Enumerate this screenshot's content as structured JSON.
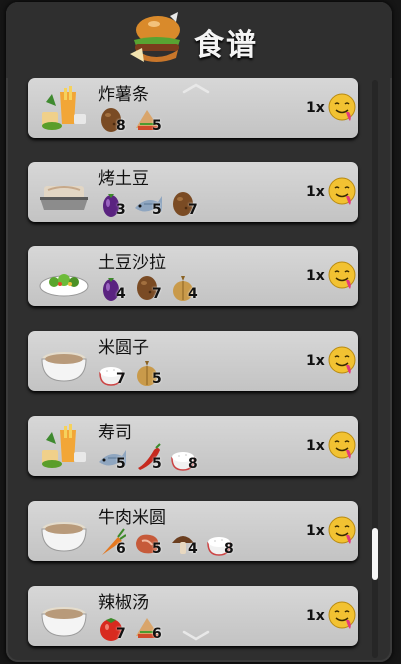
{
  "header": {
    "title": "食谱",
    "icon": "burger-icon"
  },
  "recipes": [
    {
      "name": "炸薯条",
      "dish_icon": "fries-plate-icon",
      "multiplier": "1x",
      "ingredients": [
        {
          "icon": "potato-icon",
          "qty": "8"
        },
        {
          "icon": "sandwich-icon",
          "qty": "5"
        }
      ]
    },
    {
      "name": "烤土豆",
      "dish_icon": "baking-tray-icon",
      "multiplier": "1x",
      "ingredients": [
        {
          "icon": "eggplant-icon",
          "qty": "3"
        },
        {
          "icon": "fish-icon",
          "qty": "5"
        },
        {
          "icon": "potato-icon",
          "qty": "7"
        }
      ]
    },
    {
      "name": "土豆沙拉",
      "dish_icon": "salad-plate-icon",
      "multiplier": "1x",
      "ingredients": [
        {
          "icon": "eggplant-icon",
          "qty": "4"
        },
        {
          "icon": "potato-icon",
          "qty": "7"
        },
        {
          "icon": "onion-icon",
          "qty": "4"
        }
      ]
    },
    {
      "name": "米圆子",
      "dish_icon": "bowl-icon",
      "multiplier": "1x",
      "ingredients": [
        {
          "icon": "rice-bowl-icon",
          "qty": "7"
        },
        {
          "icon": "onion-icon",
          "qty": "5"
        }
      ]
    },
    {
      "name": "寿司",
      "dish_icon": "fries-plate-icon",
      "multiplier": "1x",
      "ingredients": [
        {
          "icon": "fish-icon",
          "qty": "5"
        },
        {
          "icon": "chili-icon",
          "qty": "5"
        },
        {
          "icon": "rice-bowl-icon",
          "qty": "8"
        }
      ]
    },
    {
      "name": "牛肉米圆",
      "dish_icon": "bowl-icon",
      "multiplier": "1x",
      "ingredients": [
        {
          "icon": "carrot-icon",
          "qty": "6"
        },
        {
          "icon": "meat-icon",
          "qty": "5"
        },
        {
          "icon": "mushroom-icon",
          "qty": "4"
        },
        {
          "icon": "rice-bowl-icon",
          "qty": "8"
        }
      ]
    },
    {
      "name": "辣椒汤",
      "dish_icon": "bowl-icon",
      "multiplier": "1x",
      "ingredients": [
        {
          "icon": "tomato-icon",
          "qty": "7"
        },
        {
          "icon": "sandwich-icon",
          "qty": "6"
        }
      ]
    }
  ],
  "colors": {
    "card": "#cdcdcd",
    "panel": "#2f2f2f",
    "emoji": "#f2c232"
  }
}
